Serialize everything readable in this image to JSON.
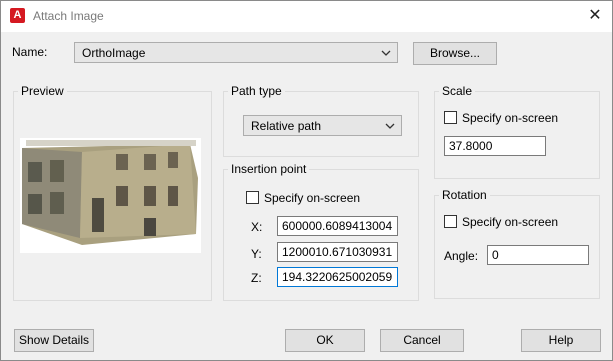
{
  "window": {
    "title": "Attach Image",
    "app_icon_letter": "A",
    "close_symbol": "✕"
  },
  "name_row": {
    "label": "Name:",
    "value": "OrthoImage",
    "browse_label": "Browse..."
  },
  "preview": {
    "label": "Preview"
  },
  "path_type": {
    "label": "Path type",
    "value": "Relative path"
  },
  "insertion_point": {
    "label": "Insertion point",
    "specify_label": "Specify on-screen",
    "specify_checked": false,
    "x_label": "X:",
    "x_value": "600000.6089413004",
    "y_label": "Y:",
    "y_value": "1200010.671030931",
    "z_label": "Z:",
    "z_value": "194.3220625002059"
  },
  "scale": {
    "label": "Scale",
    "specify_label": "Specify on-screen",
    "specify_checked": false,
    "value": "37.8000"
  },
  "rotation": {
    "label": "Rotation",
    "specify_label": "Specify on-screen",
    "specify_checked": false,
    "angle_label": "Angle:",
    "angle_value": "0"
  },
  "buttons": {
    "show_details": "Show Details",
    "ok": "OK",
    "cancel": "Cancel",
    "help": "Help"
  },
  "colors": {
    "accent": "#0078d7",
    "app_icon": "#d51921",
    "dialog_bg": "#f0f0f0"
  }
}
